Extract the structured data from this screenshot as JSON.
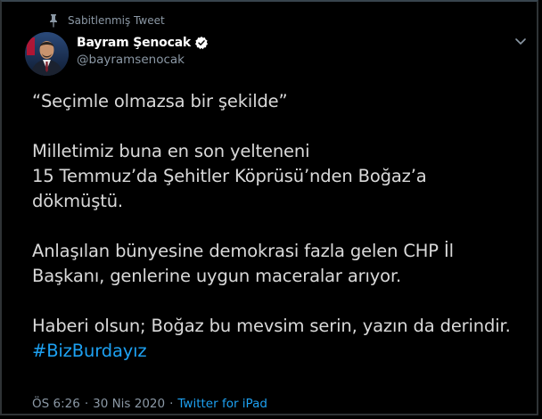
{
  "pinned": {
    "label": "Sabitlenmiş Tweet",
    "icon": "pin-icon"
  },
  "author": {
    "name": "Bayram Şenocak",
    "handle": "@bayramsenocak",
    "verified_icon": "verified-badge-icon",
    "avatar_icon": "avatar"
  },
  "tweet": {
    "paragraph1": "“Seçimle olmazsa bir şekilde”",
    "paragraph2": [
      "Milletimiz buna en son yelteneni",
      "15 Temmuz’da Şehitler Köprüsü’nden Boğaz’a",
      "dökmüştü."
    ],
    "paragraph3": [
      "Anlaşılan bünyesine demokrasi fazla gelen CHP İl",
      "Başkanı, genlerine uygun maceralar arıyor."
    ],
    "paragraph4": "Haberi olsun; Boğaz bu mevsim serin, yazın da derindir.",
    "hashtag": "#BizBurdayız"
  },
  "meta": {
    "time": "ÖS 6:26",
    "separator": "·",
    "date": "30 Nis 2020",
    "source": "Twitter for iPad"
  },
  "colors": {
    "background": "#000000",
    "text": "#d9d9d9",
    "muted": "#8b98a5",
    "link": "#1da1f2"
  }
}
